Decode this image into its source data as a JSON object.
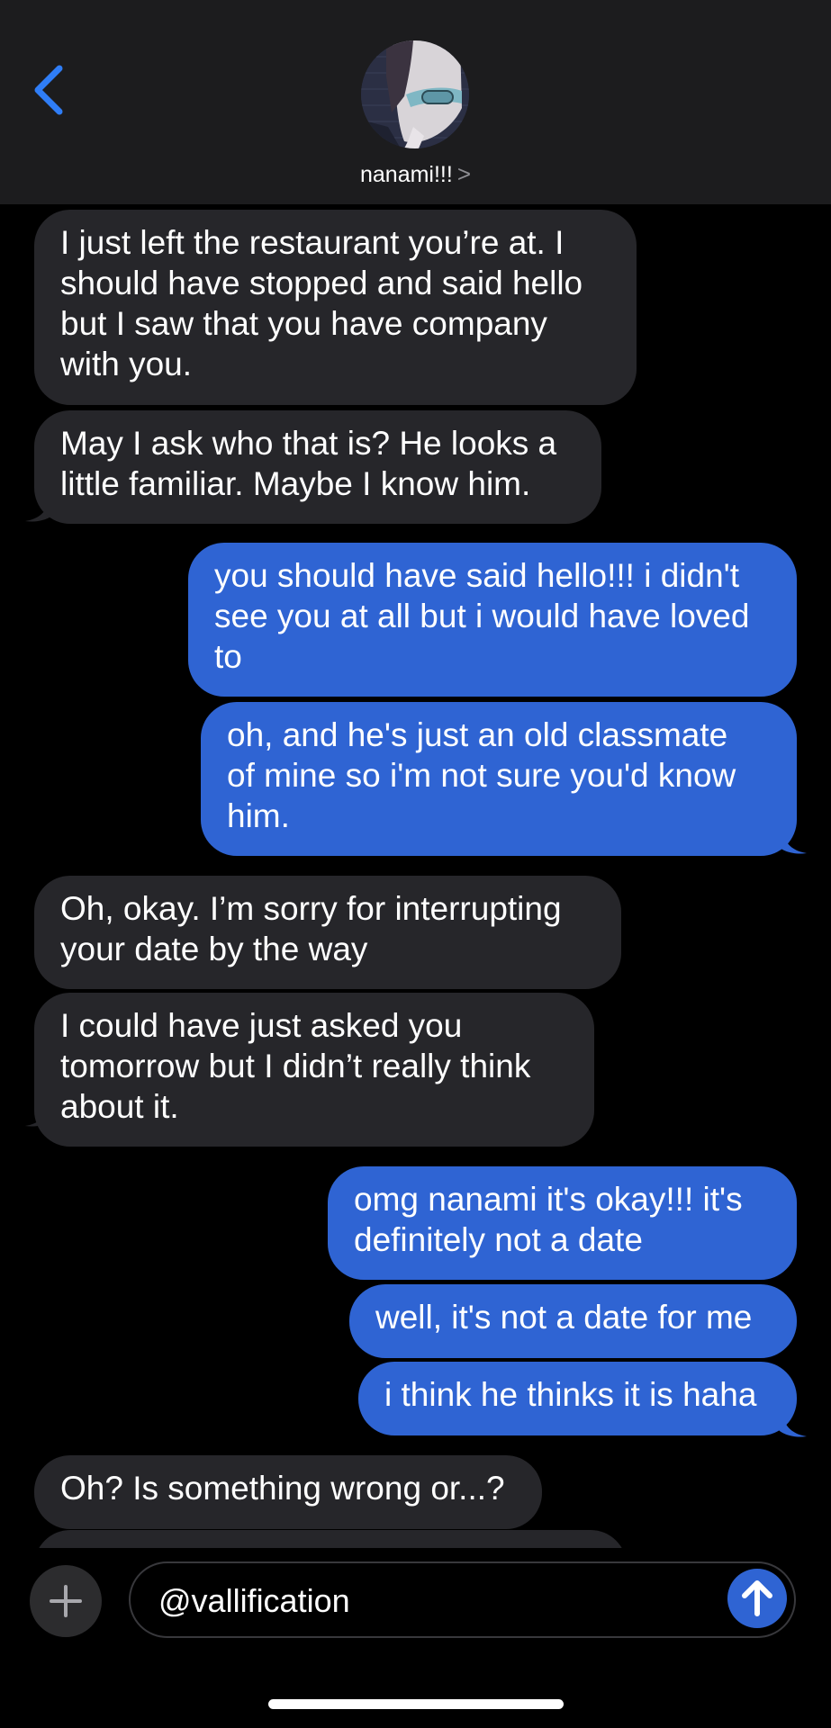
{
  "header": {
    "contact_name": "nanami!!!",
    "chevron": ">",
    "back_icon": "chevron-left-icon",
    "accent_color": "#2f7df6"
  },
  "messages": [
    {
      "from": "contact",
      "lines": [
        "I just left the restaurant you’re at. I",
        "should have stopped and said hello",
        "but I saw that you have company",
        "with you."
      ]
    },
    {
      "from": "contact",
      "lines": [
        "May I ask who that is? He looks a",
        "little familiar. Maybe I know him."
      ]
    },
    {
      "from": "me",
      "lines": [
        "you should have said hello!!! i didn't",
        "see you at all but i would have loved",
        "to"
      ]
    },
    {
      "from": "me",
      "lines": [
        "oh, and he's just an old classmate",
        "of mine so i'm not sure you'd know",
        "him."
      ]
    },
    {
      "from": "contact",
      "lines": [
        "Oh, okay. I’m sorry for interrupting",
        "your date by the way"
      ]
    },
    {
      "from": "contact",
      "lines": [
        "I could have just asked you",
        "tomorrow but I didn’t really think",
        "about it."
      ]
    },
    {
      "from": "me",
      "lines": [
        "omg nanami it's okay!!! it's",
        "definitely not a date"
      ]
    },
    {
      "from": "me",
      "lines": [
        "well, it's not a date for me"
      ]
    },
    {
      "from": "me",
      "lines": [
        "i think he thinks it is haha"
      ]
    },
    {
      "from": "contact",
      "lines": [
        "Oh? Is something wrong or...?"
      ]
    }
  ],
  "composer": {
    "plus_icon": "plus-icon",
    "input_value": "@vallification",
    "send_icon": "arrow-up-icon"
  },
  "colors": {
    "sent_bubble": "#2f64d3",
    "received_bubble": "#26262a",
    "header_bg": "#1c1c1e",
    "background": "#000000"
  }
}
